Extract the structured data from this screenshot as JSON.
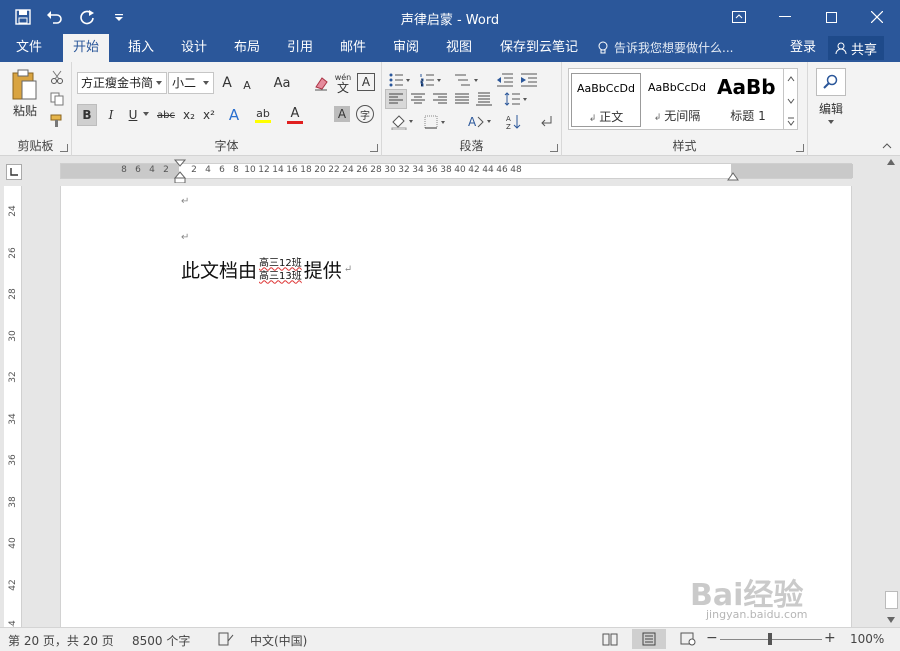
{
  "window": {
    "title": "声律启蒙 - Word",
    "controls": {
      "ribbon_display": "ribbon-display-icon",
      "minimize": "minimize-icon",
      "maximize": "maximize-icon",
      "close": "close-icon"
    }
  },
  "qat": {
    "save": "save-icon",
    "undo": "undo-icon",
    "redo": "redo-icon",
    "customize": "customize-qat-icon"
  },
  "tabs": [
    {
      "label": "文件"
    },
    {
      "label": "开始"
    },
    {
      "label": "插入"
    },
    {
      "label": "设计"
    },
    {
      "label": "布局"
    },
    {
      "label": "引用"
    },
    {
      "label": "邮件"
    },
    {
      "label": "审阅"
    },
    {
      "label": "视图"
    },
    {
      "label": "保存到云笔记"
    }
  ],
  "tell_me": "告诉我您想要做什么...",
  "login": "登录",
  "share": "共享",
  "ribbon": {
    "clipboard": {
      "label": "剪贴板",
      "paste": "粘贴"
    },
    "font": {
      "label": "字体",
      "font_name": "方正瘦金书简",
      "font_size": "小二",
      "bold": "B",
      "italic": "I",
      "underline": "U",
      "strike": "abc",
      "sub": "x₂",
      "sup": "x²",
      "grow": "A",
      "shrink": "A",
      "case": "Aa",
      "clear": "clear-format-icon",
      "phonetic_top": "wén",
      "phonetic_bottom": "文",
      "border_char": "A",
      "effects": "A",
      "highlight": "ab",
      "font_color": "A",
      "shading": "A",
      "enclosed": "字"
    },
    "paragraph": {
      "label": "段落"
    },
    "styles": {
      "label": "样式",
      "items": [
        {
          "sample": "AaBbCcDd",
          "name": "正文"
        },
        {
          "sample": "AaBbCcDd",
          "name": "无间隔"
        },
        {
          "sample": "AaBb",
          "name": "标题 1"
        }
      ]
    },
    "editing": {
      "label": "编辑"
    }
  },
  "ruler": {
    "h_left": [
      "8",
      "6",
      "4",
      "2"
    ],
    "h_right": [
      "2",
      "4",
      "6",
      "8",
      "10",
      "12",
      "14",
      "16",
      "18",
      "20",
      "22",
      "24",
      "26",
      "28",
      "30",
      "32",
      "34",
      "36",
      "38",
      "40",
      "42",
      "44",
      "46",
      "48"
    ],
    "v": [
      "24",
      "26",
      "28",
      "30",
      "32",
      "34",
      "36",
      "38",
      "40",
      "42",
      "44"
    ]
  },
  "document": {
    "para_mark": "↵",
    "text_before": "此文档由",
    "stack_top": "高三12班",
    "stack_bottom": "高三13班",
    "text_after": "提供"
  },
  "status": {
    "page": "第 20 页，共 20 页",
    "words": "8500 个字",
    "lang": "中文(中国)",
    "zoom": "100%"
  },
  "watermark": {
    "main": "Bai经验",
    "sub": "jingyan.baidu.com"
  }
}
